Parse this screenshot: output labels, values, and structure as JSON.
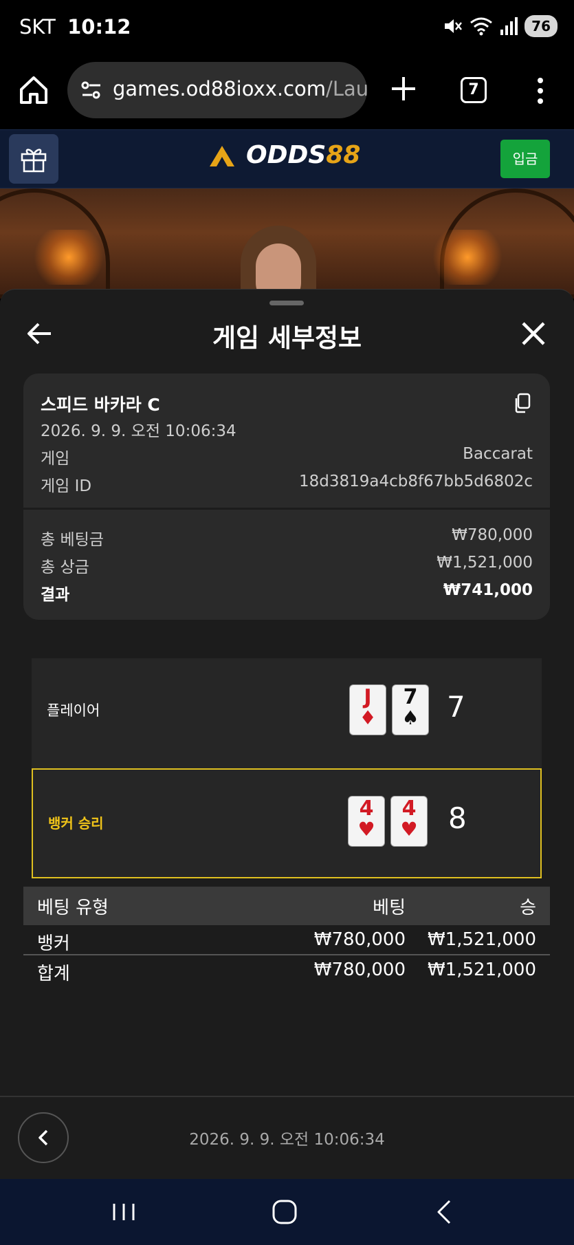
{
  "status_bar": {
    "carrier": "SKT",
    "time": "10:12",
    "battery": "76"
  },
  "browser": {
    "url_main": "games.od88ioxx.com",
    "url_path": "/Laun",
    "tab_count": "7"
  },
  "site_header": {
    "logo_text": "ODDS",
    "logo_number": "88",
    "deposit_label": "입금"
  },
  "sheet": {
    "title": "게임 세부정보",
    "game_name": "스피드 바카라 C",
    "game_datetime": "2026. 9. 9. 오전 10:06:34",
    "details": [
      {
        "label": "게임",
        "value": "Baccarat"
      },
      {
        "label": "게임 ID",
        "value": "18d3819a4cb8f67bb5d6802c"
      }
    ],
    "summary": [
      {
        "label": "총 베팅금",
        "value": "₩780,000"
      },
      {
        "label": "총 상금",
        "value": "₩1,521,000"
      },
      {
        "label": "결과",
        "value": "₩741,000"
      }
    ]
  },
  "result": {
    "player": {
      "label": "플레이어",
      "cards": [
        {
          "rank": "J",
          "suit": "♦",
          "color": "#d21a24"
        },
        {
          "rank": "7",
          "suit": "♠",
          "color": "#111111"
        }
      ],
      "score": "7"
    },
    "banker": {
      "label": "뱅커 승리",
      "cards": [
        {
          "rank": "4",
          "suit": "♥",
          "color": "#d21a24"
        },
        {
          "rank": "4",
          "suit": "♥",
          "color": "#d21a24"
        }
      ],
      "score": "8",
      "highlight_color": "#e0c020"
    }
  },
  "bet_table": {
    "headers": [
      "베팅 유형",
      "베팅",
      "승"
    ],
    "rows": [
      [
        "뱅커",
        "₩780,000",
        "₩1,521,000"
      ],
      [
        "합계",
        "₩780,000",
        "₩1,521,000"
      ]
    ]
  },
  "footer": {
    "datetime": "2026. 9. 9. 오전 10:06:34"
  },
  "colors": {
    "accent_gold": "#e6a417",
    "deposit_green": "#14a33b",
    "winner_gold": "#f0c419"
  }
}
